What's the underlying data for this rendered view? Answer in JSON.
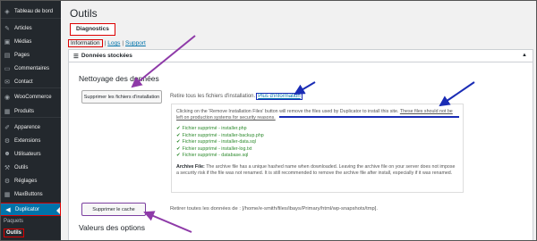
{
  "sidebar": {
    "items": [
      {
        "label": "Tableau de bord",
        "icon": "dashboard-icon",
        "glyph": "◈"
      },
      {
        "label": "Articles",
        "icon": "pin-icon",
        "glyph": "✎"
      },
      {
        "label": "Médias",
        "icon": "media-icon",
        "glyph": "▣"
      },
      {
        "label": "Pages",
        "icon": "page-icon",
        "glyph": "▤"
      },
      {
        "label": "Commentaires",
        "icon": "comment-icon",
        "glyph": "▭"
      },
      {
        "label": "Contact",
        "icon": "mail-icon",
        "glyph": "✉"
      },
      {
        "label": "WooCommerce",
        "icon": "woo-icon",
        "glyph": "◉"
      },
      {
        "label": "Produits",
        "icon": "box-icon",
        "glyph": "▦"
      },
      {
        "label": "Apparence",
        "icon": "brush-icon",
        "glyph": "✐"
      },
      {
        "label": "Extensions",
        "icon": "plugin-icon",
        "glyph": "⚙"
      },
      {
        "label": "Utilisateurs",
        "icon": "users-icon",
        "glyph": "☻"
      },
      {
        "label": "Outils",
        "icon": "tools-icon",
        "glyph": "⚒"
      },
      {
        "label": "Réglages",
        "icon": "settings-icon",
        "glyph": "⚙"
      },
      {
        "label": "MaxButtons",
        "icon": "grid-icon",
        "glyph": "▦"
      },
      {
        "label": "Duplicator",
        "icon": "duplicator-icon",
        "glyph": "◀"
      }
    ],
    "sub_header": "Paquets",
    "sub_link": "Outils"
  },
  "page": {
    "title": "Outils",
    "tab": "Diagnostics",
    "nav": {
      "current": "Information",
      "logs": "Logs",
      "support": "Support"
    }
  },
  "panel": {
    "title": "Données stockées",
    "cleanup_title": "Nettoyage des données",
    "remove_button": "Supprimer les fichiers d'installation",
    "remove_desc": "Retire tous les fichiers d'installation.",
    "more_info": "Plus d'information",
    "info_intro": "Clicking on the 'Remove Installation Files' button will remove the files used by Duplicator to install this site.",
    "info_warning": "These files should not be left on production systems for security reasons.",
    "deleted_files": [
      "Fichier supprimé - installer.php",
      "Fichier supprimé - installer-backup.php",
      "Fichier supprimé - installer-data.sql",
      "Fichier supprimé - installer-log.txt",
      "Fichier supprimé - database.sql"
    ],
    "archive_label": "Archive File:",
    "archive_text": "The archive file has a unique hashed name when downloaded. Leaving the archive file on your server does not impose a security risk if the file was not renamed. It is still recommended to remove the archive file after install, especially if it was renamed.",
    "cache_button": "Supprimer le cache",
    "cache_desc": "Retirer toutes les données de : [/home/e-smith/files/ibays/Primary/html/wp-snapshots/tmp].",
    "options_title": "Valeurs des options"
  },
  "colors": {
    "sidebar_bg": "#23282d",
    "active_bg": "#0073aa",
    "highlight_red": "#dd0000",
    "arrow_purple": "#8e3aa8",
    "arrow_blue": "#1a2cb5"
  }
}
